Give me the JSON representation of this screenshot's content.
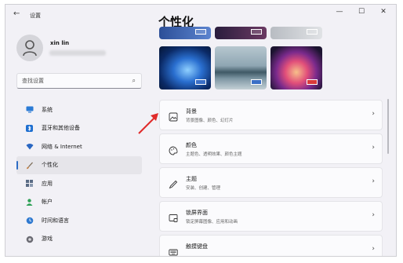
{
  "window": {
    "back_glyph": "←",
    "title": "设置",
    "minimize_glyph": "—",
    "maximize_glyph": "☐",
    "close_glyph": "✕"
  },
  "user": {
    "name": "xin lin"
  },
  "search": {
    "placeholder": "查找设置",
    "icon": "search-icon"
  },
  "sidebar": {
    "items": [
      {
        "label": "系统",
        "icon": "monitor-icon",
        "color": "#2b7bd5"
      },
      {
        "label": "蓝牙和其他设备",
        "icon": "bluetooth-icon",
        "color": "#1e6fd0"
      },
      {
        "label": "网络 & Internet",
        "icon": "wifi-icon",
        "color": "#2a67c2"
      },
      {
        "label": "个性化",
        "icon": "brush-icon",
        "color": "#c27a3a",
        "active": true
      },
      {
        "label": "应用",
        "icon": "apps-icon",
        "color": "#5a6b84"
      },
      {
        "label": "帐户",
        "icon": "person-icon",
        "color": "#2ea056"
      },
      {
        "label": "时间和语言",
        "icon": "clock-globe-icon",
        "color": "#2f79d0"
      },
      {
        "label": "游戏",
        "icon": "gamepad-icon",
        "color": "#6b6b73"
      }
    ]
  },
  "main": {
    "title": "个性化",
    "accent": "#2d6cc4",
    "cards": [
      {
        "title": "背景",
        "subtitle": "背景图像、颜色、幻灯片",
        "icon": "image-icon"
      },
      {
        "title": "颜色",
        "subtitle": "主题色、透明效果、颜色主题",
        "icon": "palette-icon"
      },
      {
        "title": "主题",
        "subtitle": "安装、创建、管理",
        "icon": "pen-icon"
      },
      {
        "title": "锁屏界面",
        "subtitle": "锁定屏幕图像、应用和动画",
        "icon": "lock-screen-icon"
      },
      {
        "title": "触摸键盘",
        "subtitle": "",
        "icon": "keyboard-icon"
      }
    ],
    "chevron_glyph": "›"
  }
}
